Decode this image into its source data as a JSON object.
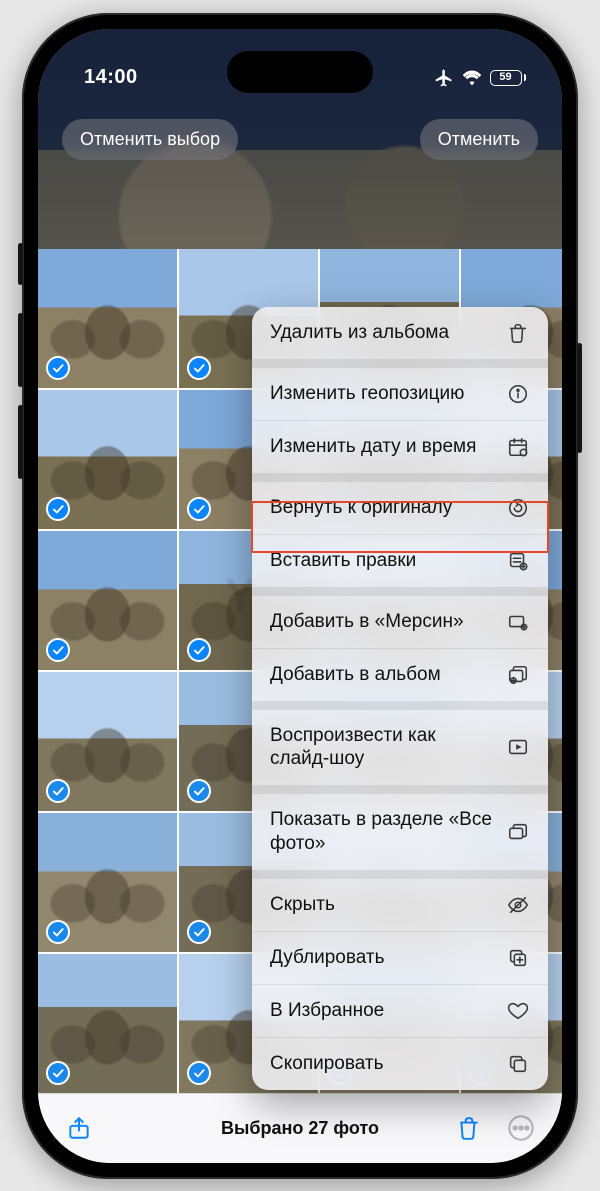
{
  "status": {
    "time": "14:00",
    "battery": "59"
  },
  "header": {
    "deselect": "Отменить выбор",
    "cancel": "Отменить"
  },
  "toolbar": {
    "selection": "Выбрано 27 фото"
  },
  "watermark": "Yablyk",
  "menu": {
    "groups": [
      [
        {
          "label": "Удалить из альбома",
          "icon": "trash"
        }
      ],
      [
        {
          "label": "Изменить геопозицию",
          "icon": "info"
        },
        {
          "label": "Изменить дату и время",
          "icon": "calendar"
        }
      ],
      [
        {
          "label": "Вернуть к оригиналу",
          "icon": "revert"
        },
        {
          "label": "Вставить правки",
          "icon": "paste-adjust",
          "highlighted": true
        }
      ],
      [
        {
          "label": "Добавить в «Мерсин»",
          "icon": "rect-plus"
        },
        {
          "label": "Добавить в альбом",
          "icon": "album-plus"
        }
      ],
      [
        {
          "label": "Воспроизвести как слайд-шоу",
          "icon": "play-rect",
          "multiline": true
        }
      ],
      [
        {
          "label": "Показать в разделе «Все фото»",
          "icon": "stack",
          "multiline": true
        }
      ],
      [
        {
          "label": "Скрыть",
          "icon": "eye-slash"
        },
        {
          "label": "Дублировать",
          "icon": "duplicate"
        },
        {
          "label": "В Избранное",
          "icon": "heart"
        },
        {
          "label": "Скопировать",
          "icon": "copy"
        }
      ]
    ]
  }
}
